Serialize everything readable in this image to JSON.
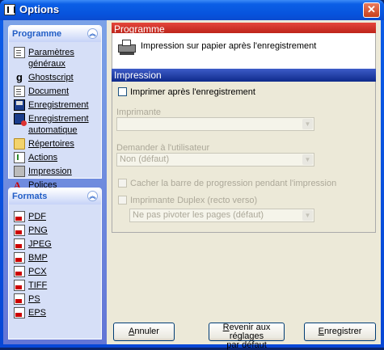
{
  "window": {
    "title": "Options"
  },
  "sidebar": {
    "programme_title": "Programme",
    "programme_items": [
      {
        "label": "Paramètres généraux",
        "icon": "document-icon"
      },
      {
        "label": "Ghostscript",
        "icon": "ghostscript-icon"
      },
      {
        "label": "Document",
        "icon": "document-icon"
      },
      {
        "label": "Enregistrement",
        "icon": "save-icon"
      },
      {
        "label": "Enregistrement automatique",
        "icon": "autosave-icon"
      },
      {
        "label": "Répertoires",
        "icon": "folder-icon"
      },
      {
        "label": "Actions",
        "icon": "actions-icon"
      },
      {
        "label": "Impression",
        "icon": "printer-icon"
      },
      {
        "label": "Polices",
        "icon": "fonts-icon"
      }
    ],
    "formats_title": "Formats",
    "format_items": [
      "PDF",
      "PNG",
      "JPEG",
      "BMP",
      "PCX",
      "TIFF",
      "PS",
      "EPS"
    ]
  },
  "main": {
    "programme_header": "Programme",
    "programme_desc": "Impression sur papier après l'enregistrement",
    "impression_header": "Impression",
    "print_after_save_label": "Imprimer après l'enregistrement",
    "printer_label": "Imprimante",
    "printer_value": "",
    "ask_user_label": "Demander à l'utilisateur",
    "ask_user_value": "Non (défaut)",
    "hide_progress_label": "Cacher la barre de progression pendant l'impression",
    "duplex_label": "Imprimante Duplex (recto verso)",
    "duplex_value": "Ne pas pivoter les pages (défaut)"
  },
  "buttons": {
    "cancel": "Annuler",
    "reset_line1": "Revenir aux réglages",
    "reset_line2": "par défaut",
    "save": "Enregistrer"
  },
  "colors": {
    "titlebar": "#0b5fe6",
    "programme_header": "#c8281e",
    "impression_header": "#1e3aa8"
  }
}
